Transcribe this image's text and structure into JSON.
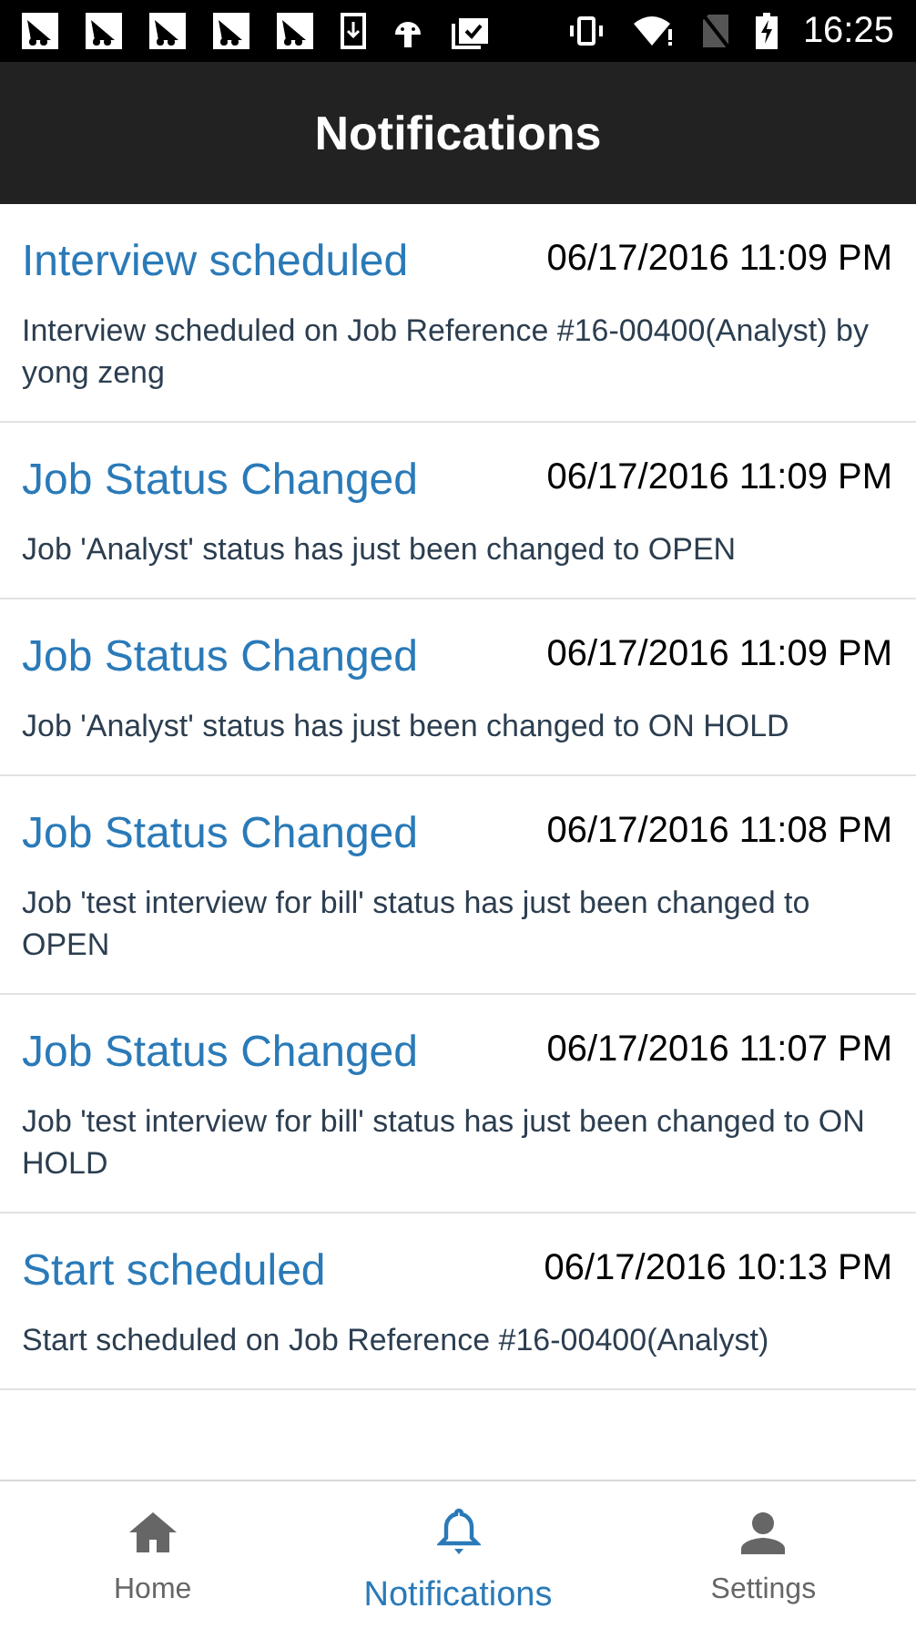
{
  "status_bar": {
    "time": "16:25"
  },
  "header": {
    "title": "Notifications"
  },
  "notifications": [
    {
      "title": "Interview scheduled",
      "time": "06/17/2016 11:09 PM",
      "body": "Interview scheduled on Job Reference #16-00400(Analyst) by yong zeng"
    },
    {
      "title": "Job Status Changed",
      "time": "06/17/2016 11:09 PM",
      "body": "Job 'Analyst' status has just been changed to OPEN"
    },
    {
      "title": "Job Status Changed",
      "time": "06/17/2016 11:09 PM",
      "body": "Job 'Analyst' status has just been changed to ON HOLD"
    },
    {
      "title": "Job Status Changed",
      "time": "06/17/2016 11:08 PM",
      "body": "Job 'test interview for bill' status has just been changed to OPEN"
    },
    {
      "title": "Job Status Changed",
      "time": "06/17/2016 11:07 PM",
      "body": "Job 'test interview for bill' status has just been changed to ON HOLD"
    },
    {
      "title": "Start scheduled",
      "time": "06/17/2016 10:13 PM",
      "body": "Start scheduled on Job Reference #16-00400(Analyst)"
    }
  ],
  "tabs": [
    {
      "kind": "home",
      "label": "Home",
      "selected": false
    },
    {
      "kind": "bell",
      "label": "Notifications",
      "selected": true
    },
    {
      "kind": "person",
      "label": "Settings",
      "selected": false
    }
  ]
}
